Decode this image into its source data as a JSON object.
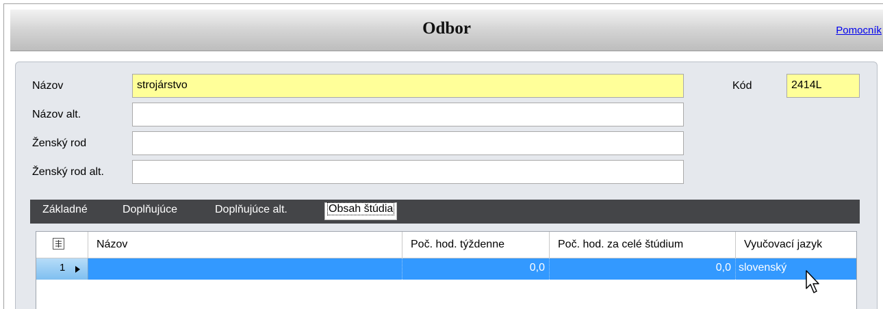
{
  "window": {
    "title": "Odbor",
    "help_link": "Pomocník"
  },
  "form": {
    "nazov": {
      "label": "Názov",
      "value": "strojárstvo"
    },
    "nazov_alt": {
      "label": "Názov alt.",
      "value": ""
    },
    "zensky_rod": {
      "label": "Ženský rod",
      "value": ""
    },
    "zensky_rod_alt": {
      "label": "Ženský rod alt.",
      "value": ""
    },
    "kod": {
      "label": "Kód",
      "value": "2414L"
    }
  },
  "tabs": [
    {
      "label": "Základné",
      "active": false
    },
    {
      "label": "Doplňujúce",
      "active": false
    },
    {
      "label": "Doplňujúce alt.",
      "active": false
    },
    {
      "label": "Obsah štúdia",
      "active": true
    }
  ],
  "grid": {
    "columns": [
      "Názov",
      "Poč. hod. týždenne",
      "Poč. hod. za celé štúdium",
      "Vyučovací jazyk"
    ],
    "rows": [
      {
        "row_number": "1",
        "nazov": "",
        "tyzdenne": "0,0",
        "cele_studium": "0,0",
        "jazyk": "slovenský"
      }
    ]
  },
  "colors": {
    "required_field": "#ffff99",
    "tab_bar": "#444548",
    "selected_row": "#3399ff",
    "panel": "#e5e8ed",
    "link": "#0000ee"
  },
  "icons": [
    "column-chooser-icon",
    "row-pointer-icon",
    "mouse-cursor-icon"
  ]
}
